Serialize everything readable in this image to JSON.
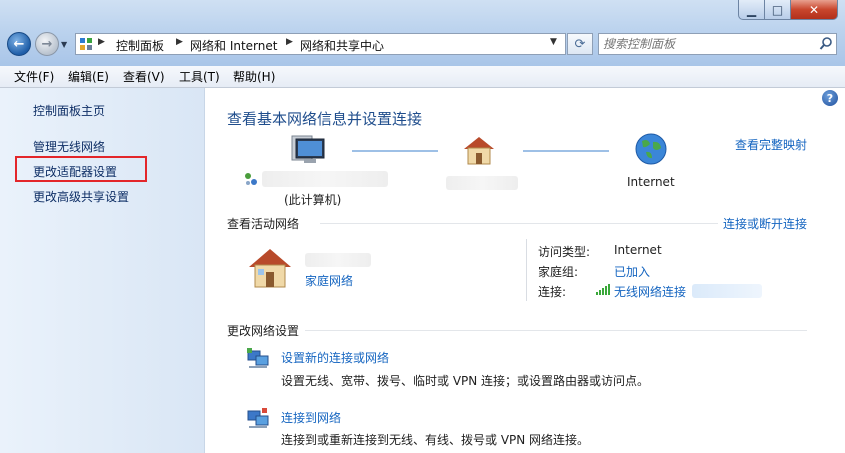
{
  "address_bar": {
    "crumbs": [
      "控制面板",
      "网络和 Internet",
      "网络和共享中心"
    ]
  },
  "search": {
    "placeholder": "搜索控制面板"
  },
  "menu": [
    "文件(F)",
    "编辑(E)",
    "查看(V)",
    "工具(T)",
    "帮助(H)"
  ],
  "sidebar": {
    "items": [
      {
        "label": "控制面板主页"
      },
      {
        "label": "管理无线网络"
      },
      {
        "label": "更改适配器设置",
        "highlighted": true
      },
      {
        "label": "更改高级共享设置"
      }
    ]
  },
  "main": {
    "title": "查看基本网络信息并设置连接",
    "full_map_link": "查看完整映射",
    "map": {
      "computer_label": "(此计算机)",
      "internet_label": "Internet"
    },
    "active": {
      "header": "查看活动网络",
      "connect_link": "连接或断开连接",
      "network_type": "家庭网络",
      "access_type_label": "访问类型:",
      "access_type_value": "Internet",
      "homegroup_label": "家庭组:",
      "homegroup_value": "已加入",
      "connections_label": "连接:",
      "connections_value": "无线网络连接"
    },
    "change": {
      "header": "更改网络设置",
      "tasks": [
        {
          "title": "设置新的连接或网络",
          "desc": "设置无线、宽带、拨号、临时或 VPN 连接；或设置路由器或访问点。"
        },
        {
          "title": "连接到网络",
          "desc": "连接到或重新连接到无线、有线、拨号或 VPN 网络连接。"
        }
      ]
    }
  },
  "colors": {
    "link": "#1565c0",
    "title": "#1f4d8c",
    "highlight": "#e3262a",
    "sidebar_bg": "#dde8f6"
  },
  "icons": [
    "back-arrow-icon",
    "forward-arrow-icon",
    "refresh-icon",
    "search-icon",
    "help-icon",
    "computer-icon",
    "house-icon",
    "globe-icon",
    "signal-icon",
    "network-setup-icon",
    "connect-icon"
  ]
}
